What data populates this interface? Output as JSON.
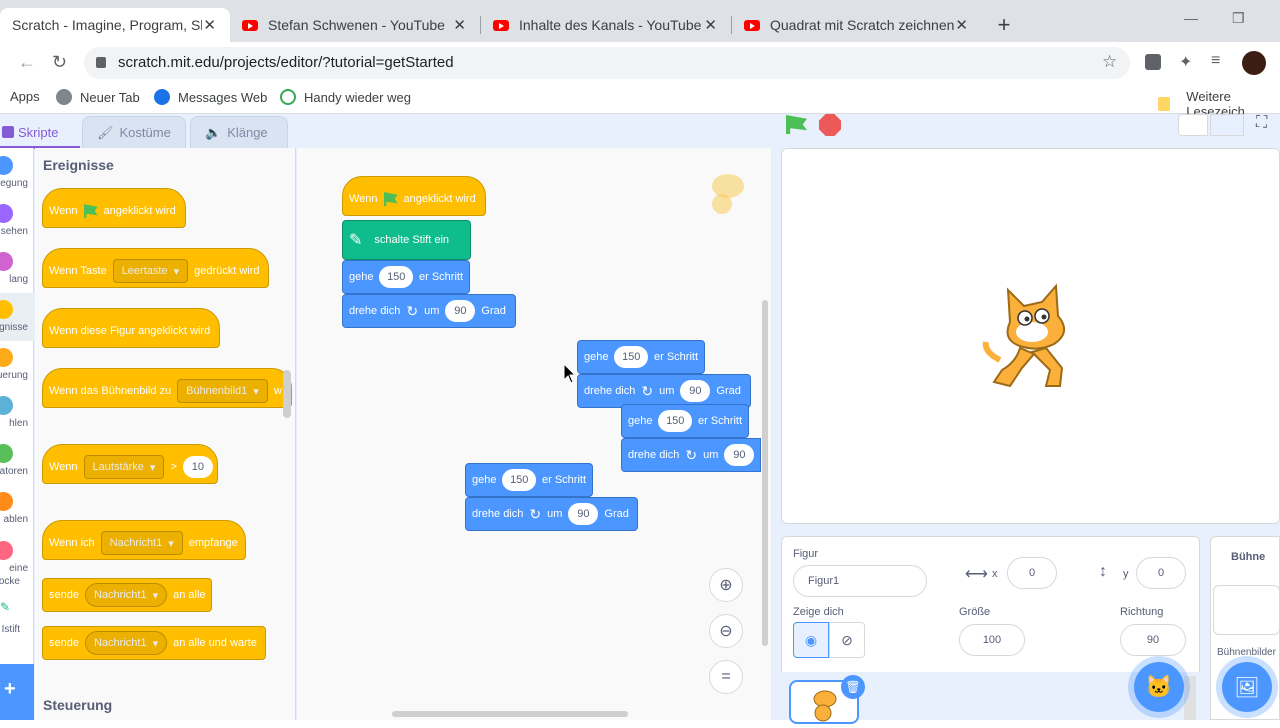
{
  "browser": {
    "tabs": [
      {
        "title": "Scratch - Imagine, Program, Share",
        "active": true
      },
      {
        "title": "Stefan Schwenen - YouTube"
      },
      {
        "title": "Inhalte des Kanals - YouTube Studio"
      },
      {
        "title": "Quadrat mit Scratch zeichnen!! G"
      }
    ],
    "url": "scratch.mit.edu/projects/editor/?tutorial=getStarted",
    "bookmarks": [
      "Apps",
      "Neuer Tab",
      "Messages Web",
      "Handy wieder weg"
    ],
    "more_bookmarks": "Weitere Lesezeich"
  },
  "scratch": {
    "tabs": {
      "scripts": "Skripte",
      "costumes": "Kostüme",
      "sounds": "Klänge"
    },
    "categories": [
      {
        "label": "egung",
        "color": "#4c97ff"
      },
      {
        "label": "sehen",
        "color": "#9966ff"
      },
      {
        "label": "lang",
        "color": "#cf63cf"
      },
      {
        "label": "eignisse",
        "color": "#ffbf00"
      },
      {
        "label": "uerung",
        "color": "#ffab19"
      },
      {
        "label": "hlen",
        "color": "#5cb1d6"
      },
      {
        "label": "atoren",
        "color": "#59c059"
      },
      {
        "label": "ablen",
        "color": "#ff8c1a"
      },
      {
        "label": "eine",
        "label2": "ocke",
        "color": "#ff6680"
      },
      {
        "label": "Istift",
        "color": "#0fbd8c"
      }
    ],
    "palette": {
      "heading_events": "Ereignisse",
      "heading_control": "Steuerung",
      "when": "Wenn",
      "flag_clicked": "angeklickt wird",
      "when_key": "Wenn Taste",
      "key_value": "Leertaste",
      "pressed": "gedrückt wird",
      "when_sprite_clicked": "Wenn diese Figur angeklickt wird",
      "when_backdrop": "Wenn das Bühnenbild zu",
      "backdrop_value": "Bühnenbild1",
      "backdrop_tail": "w",
      "loudness": "Lautstärke",
      "gt": ">",
      "loud_value": "10",
      "when_i": "Wenn ich",
      "message_value": "Nachricht1",
      "receive": "empfange",
      "send": "sende",
      "to_all": "an alle",
      "to_all_wait": "an alle und warte"
    },
    "workspace": {
      "pen_down": "schalte Stift ein",
      "move": "gehe",
      "steps": "er Schritt",
      "turn": "drehe dich",
      "by": "um",
      "degrees": "Grad",
      "move_value": "150",
      "turn_value": "90"
    },
    "sprite_info": {
      "sprite_label": "Figur",
      "sprite_name": "Figur1",
      "x_label": "x",
      "x_value": "0",
      "y_label": "y",
      "y_value": "0",
      "show_label": "Zeige dich",
      "size_label": "Größe",
      "size_value": "100",
      "direction_label": "Richtung",
      "direction_value": "90"
    },
    "stage_panel": {
      "title": "Bühne",
      "backdrops_label": "Bühnenbilder"
    }
  }
}
